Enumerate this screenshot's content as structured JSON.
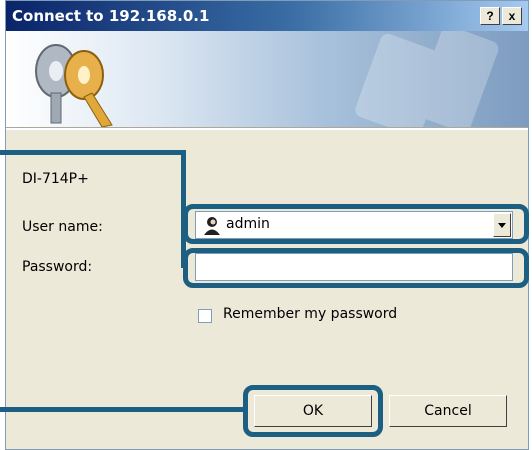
{
  "window": {
    "title": "Connect to 192.168.0.1",
    "help_label": "?",
    "close_label": "x"
  },
  "banner": {
    "icon": "keys-icon"
  },
  "device_name": "DI-714P+",
  "form": {
    "username_label": "User name:",
    "username_value": "admin",
    "username_icon": "user-icon",
    "password_label": "Password:",
    "password_value": "",
    "remember_label": "Remember my password",
    "remember_checked": false
  },
  "buttons": {
    "ok_label": "OK",
    "cancel_label": "Cancel"
  },
  "colors": {
    "callout": "#1d5f82",
    "dialog_bg": "#ece9d8",
    "title_bar": "#0a246a"
  }
}
